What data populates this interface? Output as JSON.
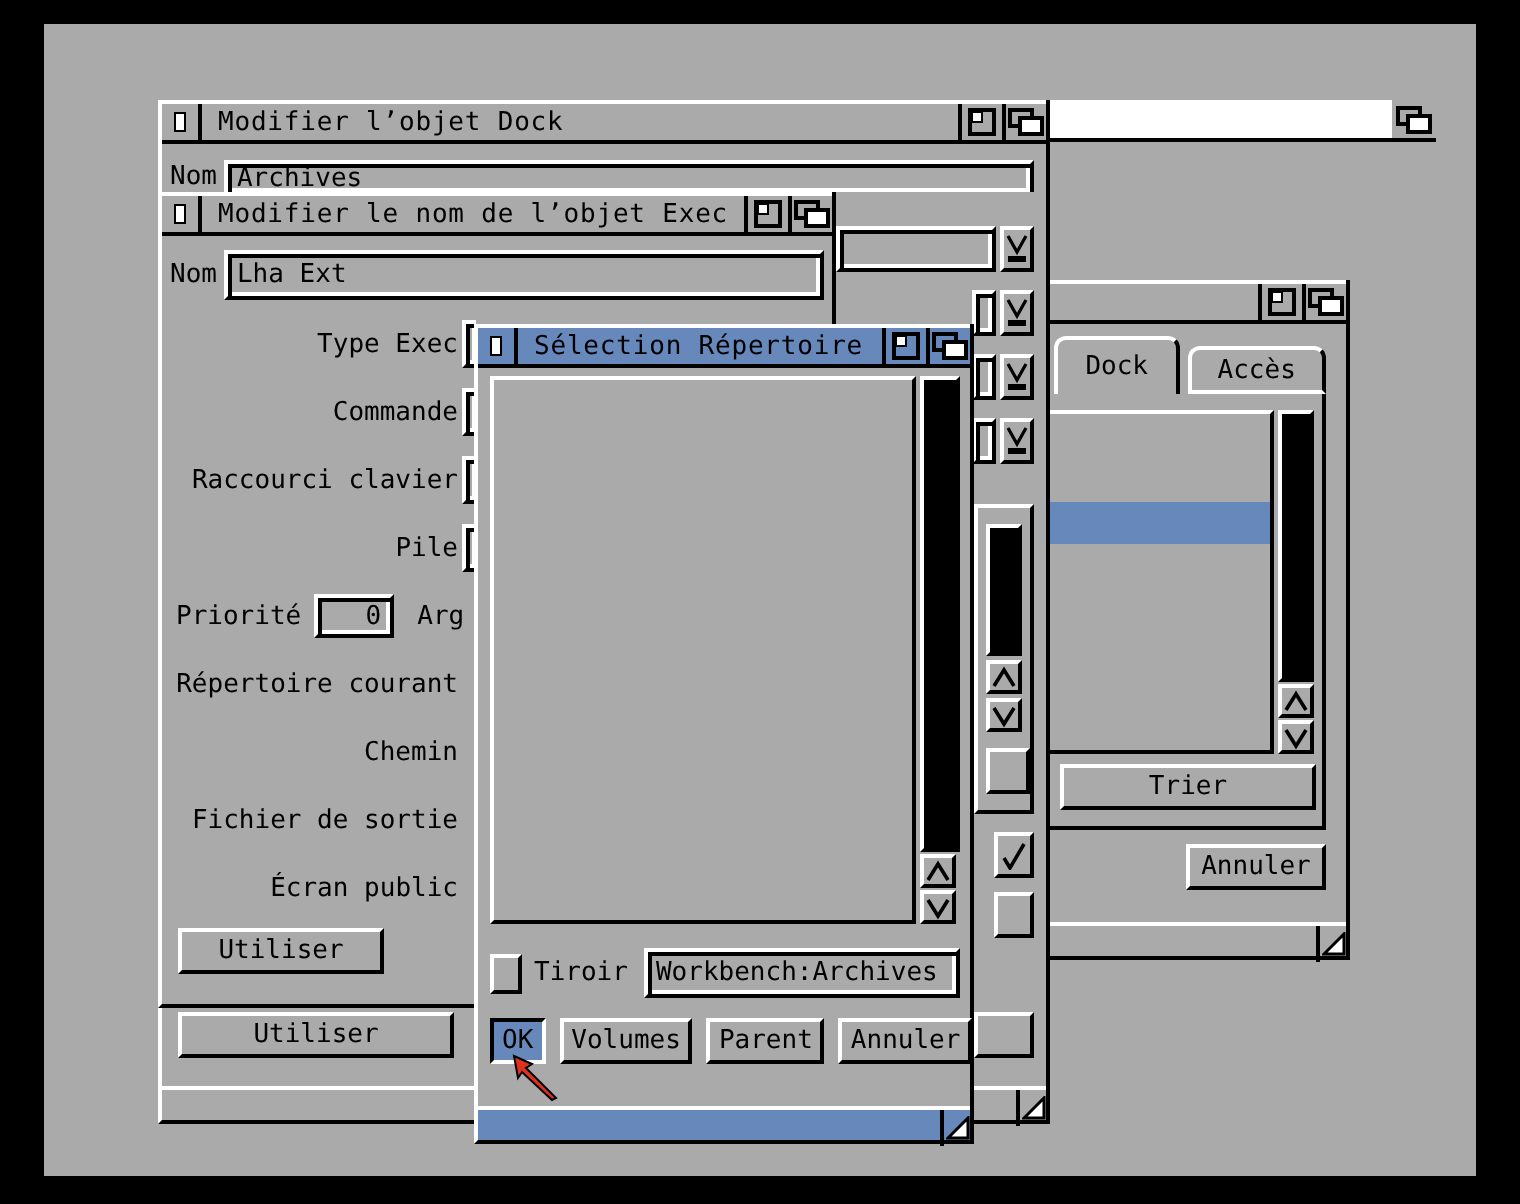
{
  "dock_window": {
    "title": "Modifier l’objet Dock",
    "name_label": "Nom",
    "name_value": "Archives",
    "choosers": [
      {
        "kind": "chooser"
      },
      {
        "kind": "chooser"
      },
      {
        "kind": "chooser"
      },
      {
        "kind": "chooser"
      }
    ],
    "checkboxes": [
      {
        "checked": true
      },
      {
        "checked": false
      }
    ],
    "button": "Utiliser"
  },
  "exec_window": {
    "title": "Modifier le nom de l’objet Exec",
    "name_label": "Nom",
    "name_value": "Lha Ext",
    "rows": [
      {
        "kind": "field",
        "label": "Type Exec"
      },
      {
        "kind": "field",
        "label": "Commande"
      },
      {
        "kind": "field",
        "label": "Raccourci clavier"
      },
      {
        "kind": "field",
        "label": "Pile"
      },
      {
        "kind": "priority",
        "label": "Priorité",
        "value": "0",
        "extra": "Arg"
      },
      {
        "kind": "text",
        "label": "Répertoire courant"
      },
      {
        "kind": "text",
        "label": "Chemin"
      },
      {
        "kind": "text",
        "label": "Fichier de sortie"
      },
      {
        "kind": "text",
        "label": "Écran public"
      }
    ],
    "button": "Utiliser"
  },
  "selector_window": {
    "title": "Sélection Répertoire",
    "drawer_label": "Tiroir",
    "drawer_checked": false,
    "path": "Workbench:Archives",
    "buttons": [
      {
        "label": "OK",
        "selected": true
      },
      {
        "label": "Volumes",
        "selected": false
      },
      {
        "label": "Parent",
        "selected": false
      },
      {
        "label": "Annuler",
        "selected": false
      }
    ]
  },
  "dock_list_window": {
    "tabs": [
      {
        "label": "Dock",
        "selected": true
      },
      {
        "label": "Accès",
        "selected": false
      }
    ],
    "highlighted_row": true,
    "sort_button": "Trier",
    "cancel_button": "Annuler"
  }
}
